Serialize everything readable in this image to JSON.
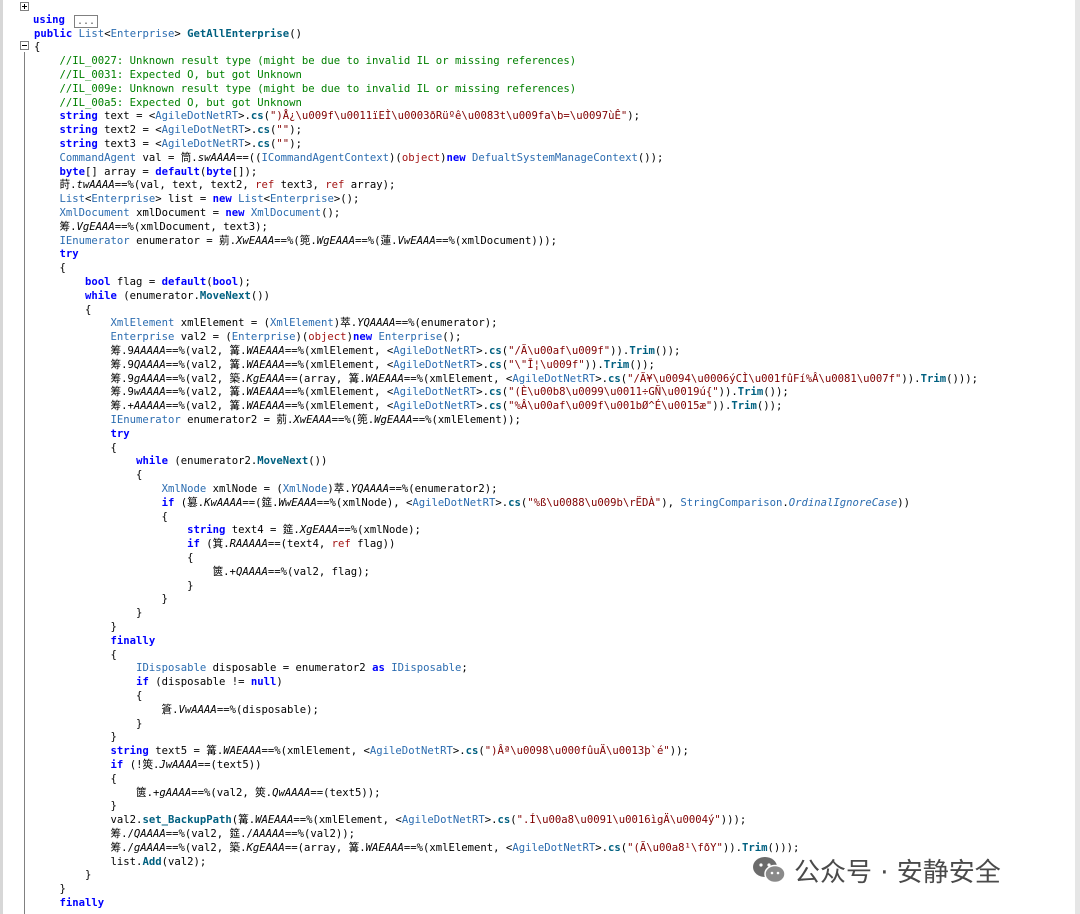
{
  "editor": {
    "using_keyword": "using",
    "using_collapsed": "...",
    "lines": [
      "public List<Enterprise> GetAllEnterprise()",
      "{",
      "    //IL_0027: Unknown result type (might be due to invalid IL or missing references)",
      "    //IL_0031: Expected O, but got Unknown",
      "    //IL_009e: Unknown result type (might be due to invalid IL or missing references)",
      "    //IL_00a5: Expected O, but got Unknown",
      "    string text = <AgileDotNetRT>.cs(\")Å¿\\u009f\\u0011ïEÌ\\u0003ðRüºê\\u0083t\\u009fa\\b=\\u0097ùÊ\");",
      "    string text2 = <AgileDotNetRT>.cs(\"\");",
      "    string text3 = <AgileDotNetRT>.cs(\"\");",
      "    CommandAgent val = 筒.swAAAA==((ICommandAgentContext)(object)new DefualtSystemManageContext());",
      "    byte[] array = default(byte[]);",
      "    莳.twAAAA==%(val, text, text2, ref text3, ref array);",
      "    List<Enterprise> list = new List<Enterprise>();",
      "    XmlDocument xmlDocument = new XmlDocument();",
      "    筹.VgEAAA==%(xmlDocument, text3);",
      "    IEnumerator enumerator = 莂.XwEAAA==%(篼.WgEAAA==%(蓮.VwEAAA==%(xmlDocument)));",
      "    try",
      "    {",
      "        bool flag = default(bool);",
      "        while (enumerator.MoveNext())",
      "        {",
      "            XmlElement xmlElement = (XmlElement)萃.YQAAAA==%(enumerator);",
      "            Enterprise val2 = (Enterprise)(object)new Enterprise();",
      "            筹.9AAAAA==%(val2, 篝.WAEAAA==%(xmlElement, <AgileDotNetRT>.cs(\"/Ã\\u00af\\u009f\")).Trim());",
      "            筹.9QAAAA==%(val2, 篝.WAEAAA==%(xmlElement, <AgileDotNetRT>.cs(\"\\\"Ī¦\\u009f\")).Trim());",
      "            筹.9gAAAA==%(val2, 築.KgEAAA==(array, 篝.WAEAAA==%(xmlElement, <AgileDotNetRT>.cs(\"/Ã¥\\u0094\\u0006ýCÌ\\u001fûFí%Â\\u0081\\u007f\")).Trim()));",
      "            筹.9wAAAA==%(val2, 篝.WAEAAA==%(xmlElement, <AgileDotNetRT>.cs(\"(È\\u00b8\\u0099\\u0011÷GÑ\\u0019ú{\")).Trim());",
      "            筹.+AAAAA==%(val2, 篝.WAEAAA==%(xmlElement, <AgileDotNetRT>.cs(\"%Â\\u00af\\u009f\\u001bØ^É\\u0015æ\")).Trim());",
      "            IEnumerator enumerator2 = 莂.XwEAAA==%(篼.WgEAAA==%(xmlElement));",
      "            try",
      "            {",
      "                while (enumerator2.MoveNext())",
      "                {",
      "                    XmlNode xmlNode = (XmlNode)萃.YQAAAA==%(enumerator2);",
      "                    if (篡.KwAAAA==(筵.WwEAAA==%(xmlNode), <AgileDotNetRT>.cs(\"%ß\\u0088\\u009b\\rËDÀ\"), StringComparison.OrdinalIgnoreCase))",
      "                    {",
      "                        string text4 = 筵.XgEAAA==%(xmlNode);",
      "                        if (箕.RAAAAA==(text4, ref flag))",
      "                        {",
      "                            篋.+QAAAA==%(val2, flag);",
      "                        }",
      "                    }",
      "                }",
      "            }",
      "            finally",
      "            {",
      "                IDisposable disposable = enumerator2 as IDisposable;",
      "                if (disposable != null)",
      "                {",
      "                    篬.VwAAAA==%(disposable);",
      "                }",
      "            }",
      "            string text5 = 篝.WAEAAA==%(xmlElement, <AgileDotNetRT>.cs(\")Âª\\u0098\\u000fûuÄ\\u0013þ`é\"));",
      "            if (!筴.JwAAAA==(text5))",
      "            {",
      "                篋.+gAAAA==%(val2, 筴.QwAAAA==(text5));",
      "            }",
      "            val2.set_BackupPath(篝.WAEAAA==%(xmlElement, <AgileDotNetRT>.cs(\".Í\\u00a8\\u0091\\u0016ìgÄ\\u0004ý\")));",
      "            筹./QAAAA==%(val2, 筵./AAAAA==%(val2));",
      "            筹./gAAAA==%(val2, 築.KgEAAA==(array, 篝.WAEAAA==%(xmlElement, <AgileDotNetRT>.cs(\"(Ã\\u00a8¹\\fðY\")).Trim()));",
      "            list.Add(val2);",
      "        }",
      "    }",
      "    finally"
    ]
  },
  "watermark": {
    "text": "公众号 · 安静安全",
    "icon": "wechat-icon"
  },
  "colors": {
    "keyword": "#0000ff",
    "comment": "#008000",
    "string": "#800000",
    "type": "#2b6cb0",
    "method": "#006080"
  }
}
